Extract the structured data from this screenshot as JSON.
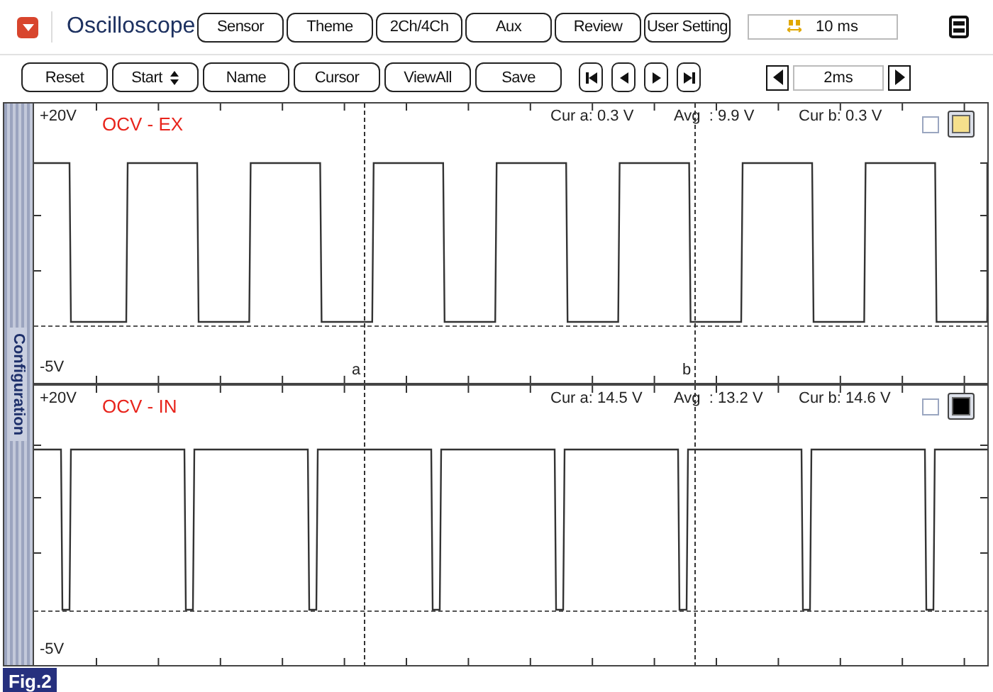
{
  "header": {
    "title": "Oscilloscope",
    "buttons": [
      "Sensor",
      "Theme",
      "2Ch/4Ch",
      "Aux",
      "Review",
      "User Setting"
    ],
    "time_per_div": "10 ms"
  },
  "toolbar": {
    "buttons": [
      "Reset",
      "Start",
      "Name",
      "Cursor",
      "ViewAll",
      "Save"
    ],
    "nav_buttons": [
      {
        "kind": "first"
      },
      {
        "kind": "prev"
      },
      {
        "kind": "next"
      },
      {
        "kind": "last"
      }
    ],
    "zoom": "2ms"
  },
  "sidebar": {
    "label": "Configuration"
  },
  "cursors": [
    {
      "label": "a"
    },
    {
      "label": "b"
    }
  ],
  "channels": [
    {
      "name": "OCV - EX",
      "max_label": "+20V",
      "min_label": "-5V",
      "cur_a": "Cur a: 0.3 V",
      "avg": "Avg  : 9.9 V",
      "cur_b": "Cur b: 0.3 V",
      "kind": "square",
      "checked": false,
      "color": "#f5e08c"
    },
    {
      "name": "OCV - IN",
      "max_label": "+20V",
      "min_label": "-5V",
      "cur_a": "Cur a: 14.5 V",
      "avg": "Avg  : 13.2 V",
      "cur_b": "Cur b: 14.6 V",
      "kind": "pulse",
      "checked": false,
      "color": "#000000"
    }
  ],
  "figure_label": "Fig.2"
}
